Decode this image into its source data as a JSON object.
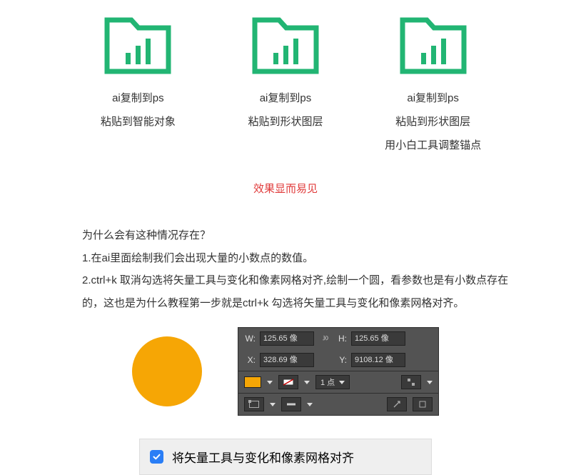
{
  "icons": {
    "folder": "folder-chart-icon",
    "link": "link-icon",
    "check": "check-icon"
  },
  "colors": {
    "green": "#22b573",
    "orange": "#f6a605",
    "red": "#e03a3a",
    "blue": "#2a7ef6",
    "panel_bg": "#535353"
  },
  "columns": [
    {
      "line1": "ai复制到ps",
      "line2": "粘贴到智能对象",
      "line3": ""
    },
    {
      "line1": "ai复制到ps",
      "line2": "粘贴到形状图层",
      "line3": ""
    },
    {
      "line1": "ai复制到ps",
      "line2": "粘贴到形状图层",
      "line3": "用小白工具调整锚点"
    }
  ],
  "effect_note": "效果显而易见",
  "body": {
    "q": "为什么会有这种情况存在？",
    "p1": "1.在ai里面绘制我们会出现大量的小数点的数值。",
    "p2": "2.ctrl+k 取消勾选将矢量工具与变化和像素网格对齐,绘制一个圆，看参数也是有小数点存在的，这也是为什么教程第一步就是ctrl+k 勾选将矢量工具与变化和像素网格对齐。"
  },
  "panel": {
    "w_label": "W:",
    "w_value": "125.65 像",
    "h_label": "H:",
    "h_value": "125.65 像",
    "x_label": "X:",
    "x_value": "328.69 像",
    "y_label": "Y:",
    "y_value": "9108.12 像",
    "stroke_size": "1 点"
  },
  "checkbox": {
    "checked": true,
    "label": "将矢量工具与变化和像素网格对齐"
  }
}
